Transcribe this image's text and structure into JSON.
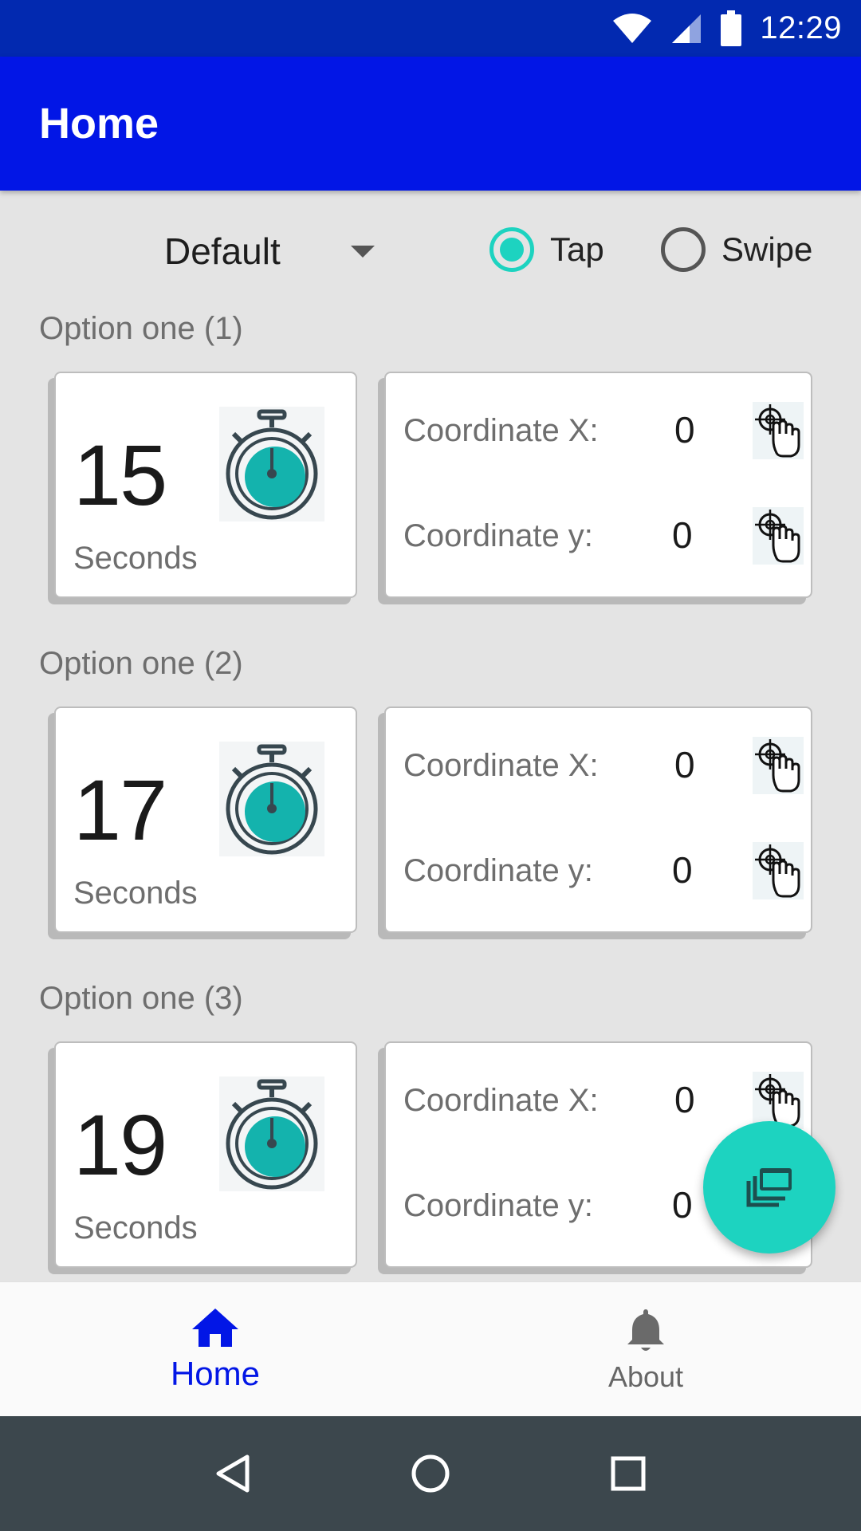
{
  "status_bar": {
    "time": "12:29",
    "icons": [
      "wifi-icon",
      "cell-signal-icon",
      "battery-icon"
    ]
  },
  "app_bar": {
    "title": "Home",
    "color": "#0216e6"
  },
  "controls": {
    "preset_dropdown": {
      "selected": "Default"
    },
    "mode": {
      "tap_label": "Tap",
      "swipe_label": "Swipe",
      "selected": "Tap"
    }
  },
  "options": [
    {
      "title": "Option one (1)",
      "timer_value": "15",
      "timer_unit": "Seconds",
      "coord_x_label": "Coordinate X:",
      "coord_x_value": "0",
      "coord_y_label": "Coordinate y:",
      "coord_y_value": "0"
    },
    {
      "title": "Option one (2)",
      "timer_value": "17",
      "timer_unit": "Seconds",
      "coord_x_label": "Coordinate X:",
      "coord_x_value": "0",
      "coord_y_label": "Coordinate y:",
      "coord_y_value": "0"
    },
    {
      "title": "Option one (3)",
      "timer_value": "19",
      "timer_unit": "Seconds",
      "coord_x_label": "Coordinate X:",
      "coord_x_value": "0",
      "coord_y_label": "Coordinate y:",
      "coord_y_value": "0"
    }
  ],
  "fab": {
    "icon": "copy-windows-icon",
    "color": "#1dd3c0"
  },
  "bottom_nav": {
    "home_label": "Home",
    "about_label": "About",
    "active": "Home",
    "active_color": "#0216e6"
  },
  "system_nav": {
    "icons": [
      "back-icon",
      "home-circle-icon",
      "recents-icon"
    ]
  },
  "colors": {
    "accent": "#1dd3c0",
    "primary": "#0216e6",
    "status_bar": "#0229b0"
  }
}
